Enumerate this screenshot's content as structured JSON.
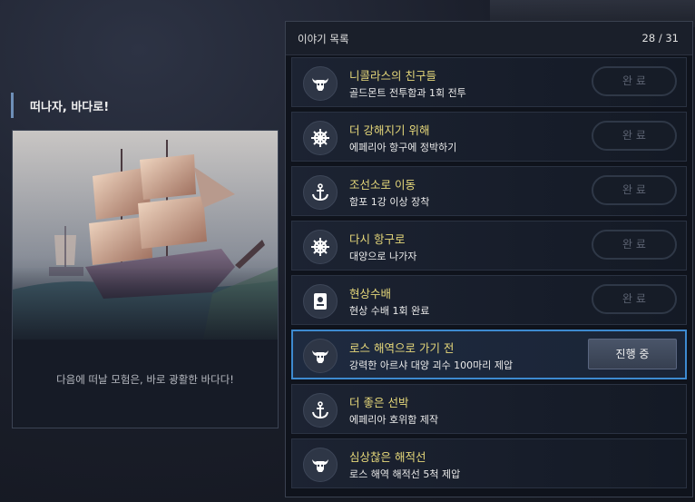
{
  "left": {
    "title": "떠나자, 바다로!",
    "caption": "다음에 떠날 모험은, 바로 광활한 바다다!"
  },
  "panel": {
    "title": "이야기 목록",
    "count": "28 / 31"
  },
  "quests": [
    {
      "title": "니콜라스의 친구들",
      "sub": "골드몬트 전투함과 1회 전투",
      "icon": "bull-skull-icon",
      "status": "완 료"
    },
    {
      "title": "더 강해지기 위해",
      "sub": "에페리아 항구에 정박하기",
      "icon": "ship-wheel-icon",
      "status": "완 료"
    },
    {
      "title": "조선소로 이동",
      "sub": "함포 1강 이상 장착",
      "icon": "anchor-icon",
      "status": "완 료"
    },
    {
      "title": "다시 항구로",
      "sub": "대양으로 나가자",
      "icon": "ship-wheel-icon",
      "status": "완 료"
    },
    {
      "title": "현상수배",
      "sub": "현상 수배 1회 완료",
      "icon": "wanted-poster-icon",
      "status": "완 료"
    },
    {
      "title": "로스 해역으로 가기 전",
      "sub": "강력한 아르샤 대양 괴수 100마리 제압",
      "icon": "bull-skull-icon",
      "status": "진행 중"
    },
    {
      "title": "더 좋은 선박",
      "sub": "에페리아 호위함 제작",
      "icon": "anchor-icon",
      "status": ""
    },
    {
      "title": "심상찮은 해적선",
      "sub": "로스 해역 해적선 5척 제압",
      "icon": "bull-skull-icon",
      "status": ""
    }
  ],
  "colors": {
    "quest_title": "#e6d87a",
    "active_border": "#3d8ad0",
    "panel_bg": "#0f131c"
  }
}
